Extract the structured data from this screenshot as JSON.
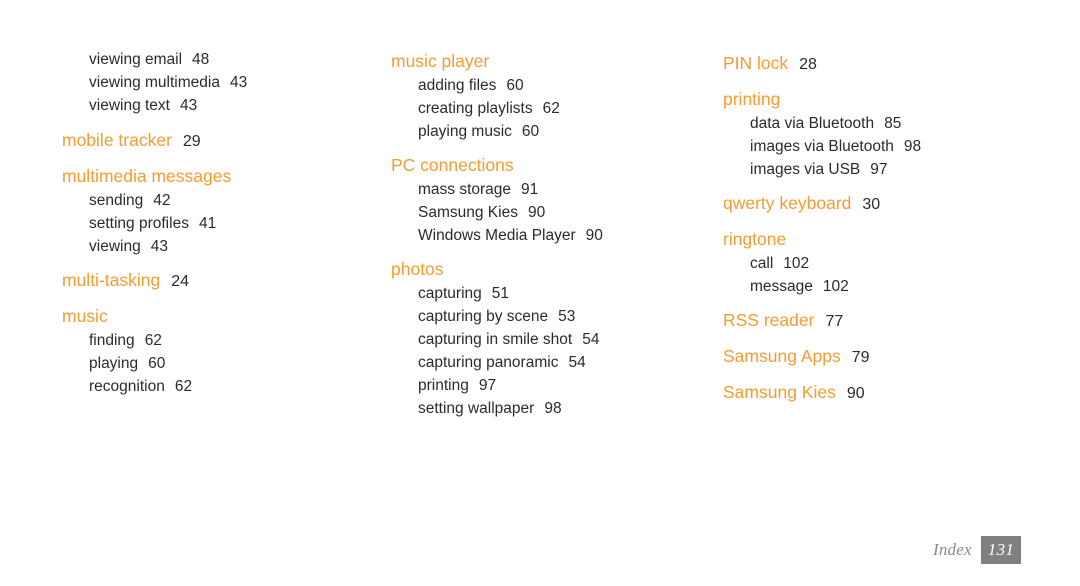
{
  "document": {
    "type": "index-page",
    "colors": {
      "heading": "#f59b33",
      "body_text": "#2b2b2b",
      "footer_text": "#8a8a8a",
      "footer_box_bg": "#808080",
      "footer_box_text": "#ffffff",
      "background": "#ffffff"
    }
  },
  "columns": [
    {
      "id": "column-1",
      "groups": [
        {
          "heading": null,
          "continuation": true,
          "entries": [
            {
              "label": "viewing email",
              "page": "48"
            },
            {
              "label": "viewing multimedia",
              "page": "43"
            },
            {
              "label": "viewing text",
              "page": "43"
            }
          ]
        },
        {
          "heading": "mobile tracker",
          "heading_page": "29",
          "entries": []
        },
        {
          "heading": "multimedia messages",
          "heading_page": null,
          "entries": [
            {
              "label": "sending",
              "page": "42"
            },
            {
              "label": "setting profiles",
              "page": "41"
            },
            {
              "label": "viewing",
              "page": "43"
            }
          ]
        },
        {
          "heading": "multi-tasking",
          "heading_page": "24",
          "entries": []
        },
        {
          "heading": "music",
          "heading_page": null,
          "entries": [
            {
              "label": "finding",
              "page": "62"
            },
            {
              "label": "playing",
              "page": "60"
            },
            {
              "label": "recognition",
              "page": "62"
            }
          ]
        }
      ]
    },
    {
      "id": "column-2",
      "groups": [
        {
          "heading": "music player",
          "heading_page": null,
          "entries": [
            {
              "label": "adding files",
              "page": "60"
            },
            {
              "label": "creating playlists",
              "page": "62"
            },
            {
              "label": "playing music",
              "page": "60"
            }
          ]
        },
        {
          "heading": "PC connections",
          "heading_page": null,
          "entries": [
            {
              "label": "mass storage",
              "page": "91"
            },
            {
              "label": "Samsung Kies",
              "page": "90"
            },
            {
              "label": "Windows Media Player",
              "page": "90"
            }
          ]
        },
        {
          "heading": "photos",
          "heading_page": null,
          "entries": [
            {
              "label": "capturing",
              "page": "51"
            },
            {
              "label": "capturing by scene",
              "page": "53"
            },
            {
              "label": "capturing in smile shot",
              "page": "54"
            },
            {
              "label": "capturing panoramic",
              "page": "54"
            },
            {
              "label": "printing",
              "page": "97"
            },
            {
              "label": "setting wallpaper",
              "page": "98"
            }
          ]
        }
      ]
    },
    {
      "id": "column-3",
      "groups": [
        {
          "heading": "PIN lock",
          "heading_page": "28",
          "entries": []
        },
        {
          "heading": "printing",
          "heading_page": null,
          "entries": [
            {
              "label": "data via Bluetooth",
              "page": "85"
            },
            {
              "label": "images via Bluetooth",
              "page": "98"
            },
            {
              "label": "images via USB",
              "page": "97"
            }
          ]
        },
        {
          "heading": "qwerty keyboard",
          "heading_page": "30",
          "entries": []
        },
        {
          "heading": "ringtone",
          "heading_page": null,
          "entries": [
            {
              "label": "call",
              "page": "102"
            },
            {
              "label": "message",
              "page": "102"
            }
          ]
        },
        {
          "heading": "RSS reader",
          "heading_page": "77",
          "entries": []
        },
        {
          "heading": "Samsung Apps",
          "heading_page": "79",
          "entries": []
        },
        {
          "heading": "Samsung Kies",
          "heading_page": "90",
          "entries": []
        }
      ]
    }
  ],
  "footer": {
    "label": "Index",
    "page_number": "131"
  }
}
